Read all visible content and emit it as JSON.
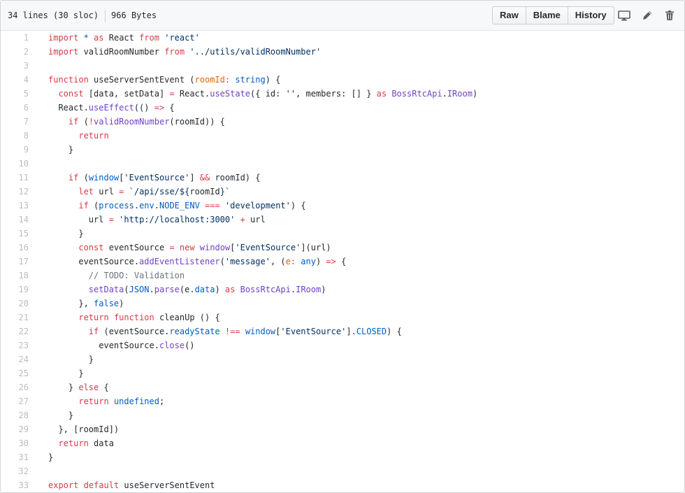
{
  "file": {
    "lines_info": "34 lines (30 sloc)",
    "size": "966 Bytes"
  },
  "toolbar": {
    "raw_label": "Raw",
    "blame_label": "Blame",
    "history_label": "History",
    "icons": [
      "desktop-icon",
      "pencil-icon",
      "trash-icon"
    ]
  },
  "code": {
    "lines": [
      {
        "n": "1",
        "t": [
          [
            "k",
            "import"
          ],
          [
            "p",
            " "
          ],
          [
            "c",
            "*"
          ],
          [
            "p",
            " "
          ],
          [
            "k",
            "as"
          ],
          [
            "p",
            " React "
          ],
          [
            "k",
            "from"
          ],
          [
            "p",
            " "
          ],
          [
            "s",
            "'react'"
          ]
        ]
      },
      {
        "n": "2",
        "t": [
          [
            "k",
            "import"
          ],
          [
            "p",
            " validRoomNumber "
          ],
          [
            "k",
            "from"
          ],
          [
            "p",
            " "
          ],
          [
            "s",
            "'../utils/validRoomNumber'"
          ]
        ]
      },
      {
        "n": "3",
        "t": []
      },
      {
        "n": "4",
        "t": [
          [
            "k",
            "function"
          ],
          [
            "p",
            " useServerSentEvent ("
          ],
          [
            "v",
            "roomId"
          ],
          [
            "k",
            ":"
          ],
          [
            "p",
            " "
          ],
          [
            "c",
            "string"
          ],
          [
            "p",
            ") {"
          ]
        ]
      },
      {
        "n": "5",
        "t": [
          [
            "p",
            "  "
          ],
          [
            "k",
            "const"
          ],
          [
            "p",
            " [data, setData] "
          ],
          [
            "k",
            "="
          ],
          [
            "p",
            " React."
          ],
          [
            "f",
            "useState"
          ],
          [
            "p",
            "({ id: "
          ],
          [
            "s",
            "''"
          ],
          [
            "p",
            ", members: [] } "
          ],
          [
            "k",
            "as"
          ],
          [
            "p",
            " "
          ],
          [
            "f",
            "BossRtcApi"
          ],
          [
            "p",
            "."
          ],
          [
            "f",
            "IRoom"
          ],
          [
            "p",
            ")"
          ]
        ]
      },
      {
        "n": "6",
        "t": [
          [
            "p",
            "  React."
          ],
          [
            "f",
            "useEffect"
          ],
          [
            "p",
            "(() "
          ],
          [
            "k",
            "=>"
          ],
          [
            "p",
            " {"
          ]
        ]
      },
      {
        "n": "7",
        "t": [
          [
            "p",
            "    "
          ],
          [
            "k",
            "if"
          ],
          [
            "p",
            " ("
          ],
          [
            "k",
            "!"
          ],
          [
            "f",
            "validRoomNumber"
          ],
          [
            "p",
            "(roomId)) {"
          ]
        ]
      },
      {
        "n": "8",
        "t": [
          [
            "p",
            "      "
          ],
          [
            "k",
            "return"
          ]
        ]
      },
      {
        "n": "9",
        "t": [
          [
            "p",
            "    }"
          ]
        ]
      },
      {
        "n": "10",
        "t": []
      },
      {
        "n": "11",
        "t": [
          [
            "p",
            "    "
          ],
          [
            "k",
            "if"
          ],
          [
            "p",
            " ("
          ],
          [
            "c",
            "window"
          ],
          [
            "p",
            "["
          ],
          [
            "s",
            "'EventSource'"
          ],
          [
            "p",
            "] "
          ],
          [
            "k",
            "&&"
          ],
          [
            "p",
            " roomId) {"
          ]
        ]
      },
      {
        "n": "12",
        "t": [
          [
            "p",
            "      "
          ],
          [
            "k",
            "let"
          ],
          [
            "p",
            " url "
          ],
          [
            "k",
            "="
          ],
          [
            "p",
            " "
          ],
          [
            "s",
            "`/api/sse/${"
          ],
          [
            "p",
            "roomId"
          ],
          [
            "s",
            "}`"
          ]
        ]
      },
      {
        "n": "13",
        "t": [
          [
            "p",
            "      "
          ],
          [
            "k",
            "if"
          ],
          [
            "p",
            " ("
          ],
          [
            "c",
            "process"
          ],
          [
            "p",
            "."
          ],
          [
            "c",
            "env"
          ],
          [
            "p",
            "."
          ],
          [
            "c",
            "NODE_ENV"
          ],
          [
            "p",
            " "
          ],
          [
            "k",
            "==="
          ],
          [
            "p",
            " "
          ],
          [
            "s",
            "'development'"
          ],
          [
            "p",
            ") {"
          ]
        ]
      },
      {
        "n": "14",
        "t": [
          [
            "p",
            "        url "
          ],
          [
            "k",
            "="
          ],
          [
            "p",
            " "
          ],
          [
            "s",
            "'http://localhost:3000'"
          ],
          [
            "p",
            " "
          ],
          [
            "k",
            "+"
          ],
          [
            "p",
            " url"
          ]
        ]
      },
      {
        "n": "15",
        "t": [
          [
            "p",
            "      }"
          ]
        ]
      },
      {
        "n": "16",
        "t": [
          [
            "p",
            "      "
          ],
          [
            "k",
            "const"
          ],
          [
            "p",
            " eventSource "
          ],
          [
            "k",
            "="
          ],
          [
            "p",
            " "
          ],
          [
            "k",
            "new"
          ],
          [
            "p",
            " "
          ],
          [
            "f",
            "window"
          ],
          [
            "p",
            "["
          ],
          [
            "s",
            "'EventSource'"
          ],
          [
            "p",
            "](url)"
          ]
        ]
      },
      {
        "n": "17",
        "t": [
          [
            "p",
            "      eventSource."
          ],
          [
            "f",
            "addEventListener"
          ],
          [
            "p",
            "("
          ],
          [
            "s",
            "'message'"
          ],
          [
            "p",
            ", ("
          ],
          [
            "v",
            "e"
          ],
          [
            "k",
            ":"
          ],
          [
            "p",
            " "
          ],
          [
            "c",
            "any"
          ],
          [
            "p",
            ") "
          ],
          [
            "k",
            "=>"
          ],
          [
            "p",
            " {"
          ]
        ]
      },
      {
        "n": "18",
        "t": [
          [
            "p",
            "        "
          ],
          [
            "m",
            "// TODO: Validation"
          ]
        ]
      },
      {
        "n": "19",
        "t": [
          [
            "p",
            "        "
          ],
          [
            "f",
            "setData"
          ],
          [
            "p",
            "("
          ],
          [
            "c",
            "JSON"
          ],
          [
            "p",
            "."
          ],
          [
            "f",
            "parse"
          ],
          [
            "p",
            "(e."
          ],
          [
            "c",
            "data"
          ],
          [
            "p",
            ") "
          ],
          [
            "k",
            "as"
          ],
          [
            "p",
            " "
          ],
          [
            "f",
            "BossRtcApi"
          ],
          [
            "p",
            "."
          ],
          [
            "f",
            "IRoom"
          ],
          [
            "p",
            ")"
          ]
        ]
      },
      {
        "n": "20",
        "t": [
          [
            "p",
            "      }, "
          ],
          [
            "c",
            "false"
          ],
          [
            "p",
            ")"
          ]
        ]
      },
      {
        "n": "21",
        "t": [
          [
            "p",
            "      "
          ],
          [
            "k",
            "return"
          ],
          [
            "p",
            " "
          ],
          [
            "k",
            "function"
          ],
          [
            "p",
            " cleanUp () {"
          ]
        ]
      },
      {
        "n": "22",
        "t": [
          [
            "p",
            "        "
          ],
          [
            "k",
            "if"
          ],
          [
            "p",
            " (eventSource."
          ],
          [
            "c",
            "readyState"
          ],
          [
            "p",
            " "
          ],
          [
            "k",
            "!=="
          ],
          [
            "p",
            " "
          ],
          [
            "c",
            "window"
          ],
          [
            "p",
            "["
          ],
          [
            "s",
            "'EventSource'"
          ],
          [
            "p",
            "]."
          ],
          [
            "c",
            "CLOSED"
          ],
          [
            "p",
            ") {"
          ]
        ]
      },
      {
        "n": "23",
        "t": [
          [
            "p",
            "          eventSource."
          ],
          [
            "f",
            "close"
          ],
          [
            "p",
            "()"
          ]
        ]
      },
      {
        "n": "24",
        "t": [
          [
            "p",
            "        }"
          ]
        ]
      },
      {
        "n": "25",
        "t": [
          [
            "p",
            "      }"
          ]
        ]
      },
      {
        "n": "26",
        "t": [
          [
            "p",
            "    } "
          ],
          [
            "k",
            "else"
          ],
          [
            "p",
            " {"
          ]
        ]
      },
      {
        "n": "27",
        "t": [
          [
            "p",
            "      "
          ],
          [
            "k",
            "return"
          ],
          [
            "p",
            " "
          ],
          [
            "c",
            "undefined"
          ],
          [
            "p",
            ";"
          ]
        ]
      },
      {
        "n": "28",
        "t": [
          [
            "p",
            "    }"
          ]
        ]
      },
      {
        "n": "29",
        "t": [
          [
            "p",
            "  }, [roomId])"
          ]
        ]
      },
      {
        "n": "30",
        "t": [
          [
            "p",
            "  "
          ],
          [
            "k",
            "return"
          ],
          [
            "p",
            " data"
          ]
        ]
      },
      {
        "n": "31",
        "t": [
          [
            "p",
            "}"
          ]
        ]
      },
      {
        "n": "32",
        "t": []
      },
      {
        "n": "33",
        "t": [
          [
            "k",
            "export"
          ],
          [
            "p",
            " "
          ],
          [
            "k",
            "default"
          ],
          [
            "p",
            " useServerSentEvent"
          ]
        ]
      }
    ]
  }
}
